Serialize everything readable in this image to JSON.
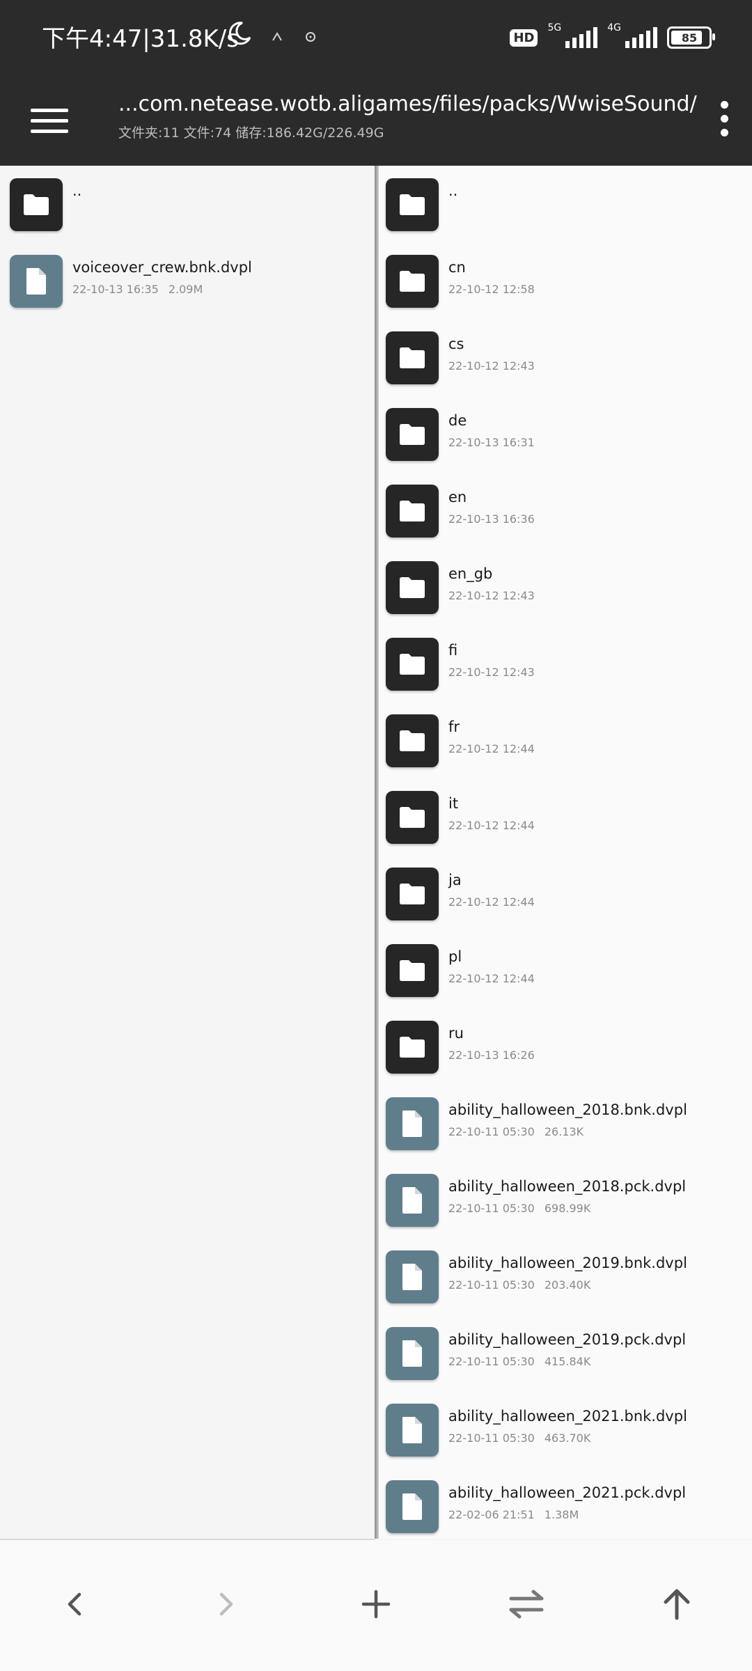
{
  "statusbar": {
    "time": "下午4:47|31.8K/s",
    "hd": "HD",
    "net1": "5G",
    "net2": "4G",
    "battery": "85",
    "battery_level": 0.85
  },
  "toolbar": {
    "path": "...com.netease.wotb.aligames/files/packs/WwiseSound/",
    "summary": "文件夹:11  文件:74  储存:186.42G/226.49G"
  },
  "left_panel": {
    "items": [
      {
        "type": "folder",
        "name": "..",
        "date": "",
        "size": ""
      },
      {
        "type": "file",
        "name": "voiceover_crew.bnk.dvpl",
        "date": "22-10-13 16:35",
        "size": "2.09M"
      }
    ]
  },
  "right_panel": {
    "items": [
      {
        "type": "folder",
        "name": "..",
        "date": "",
        "size": ""
      },
      {
        "type": "folder",
        "name": "cn",
        "date": "22-10-12 12:58",
        "size": ""
      },
      {
        "type": "folder",
        "name": "cs",
        "date": "22-10-12 12:43",
        "size": ""
      },
      {
        "type": "folder",
        "name": "de",
        "date": "22-10-13 16:31",
        "size": ""
      },
      {
        "type": "folder",
        "name": "en",
        "date": "22-10-13 16:36",
        "size": ""
      },
      {
        "type": "folder",
        "name": "en_gb",
        "date": "22-10-12 12:43",
        "size": ""
      },
      {
        "type": "folder",
        "name": "fi",
        "date": "22-10-12 12:43",
        "size": ""
      },
      {
        "type": "folder",
        "name": "fr",
        "date": "22-10-12 12:44",
        "size": ""
      },
      {
        "type": "folder",
        "name": "it",
        "date": "22-10-12 12:44",
        "size": ""
      },
      {
        "type": "folder",
        "name": "ja",
        "date": "22-10-12 12:44",
        "size": ""
      },
      {
        "type": "folder",
        "name": "pl",
        "date": "22-10-12 12:44",
        "size": ""
      },
      {
        "type": "folder",
        "name": "ru",
        "date": "22-10-13 16:26",
        "size": ""
      },
      {
        "type": "file",
        "name": "ability_halloween_2018.bnk.dvpl",
        "date": "22-10-11 05:30",
        "size": "26.13K"
      },
      {
        "type": "file",
        "name": "ability_halloween_2018.pck.dvpl",
        "date": "22-10-11 05:30",
        "size": "698.99K"
      },
      {
        "type": "file",
        "name": "ability_halloween_2019.bnk.dvpl",
        "date": "22-10-11 05:30",
        "size": "203.40K"
      },
      {
        "type": "file",
        "name": "ability_halloween_2019.pck.dvpl",
        "date": "22-10-11 05:30",
        "size": "415.84K"
      },
      {
        "type": "file",
        "name": "ability_halloween_2021.bnk.dvpl",
        "date": "22-10-11 05:30",
        "size": "463.70K"
      },
      {
        "type": "file",
        "name": "ability_halloween_2021.pck.dvpl",
        "date": "22-02-06 21:51",
        "size": "1.38M"
      }
    ]
  },
  "bottomnav": {
    "buttons": [
      {
        "icon": "chevron-left-icon",
        "enabled": true
      },
      {
        "icon": "chevron-right-icon",
        "enabled": false
      },
      {
        "icon": "plus-icon",
        "enabled": true
      },
      {
        "icon": "swap-icon",
        "enabled": true
      },
      {
        "icon": "arrow-up-icon",
        "enabled": true
      }
    ]
  }
}
